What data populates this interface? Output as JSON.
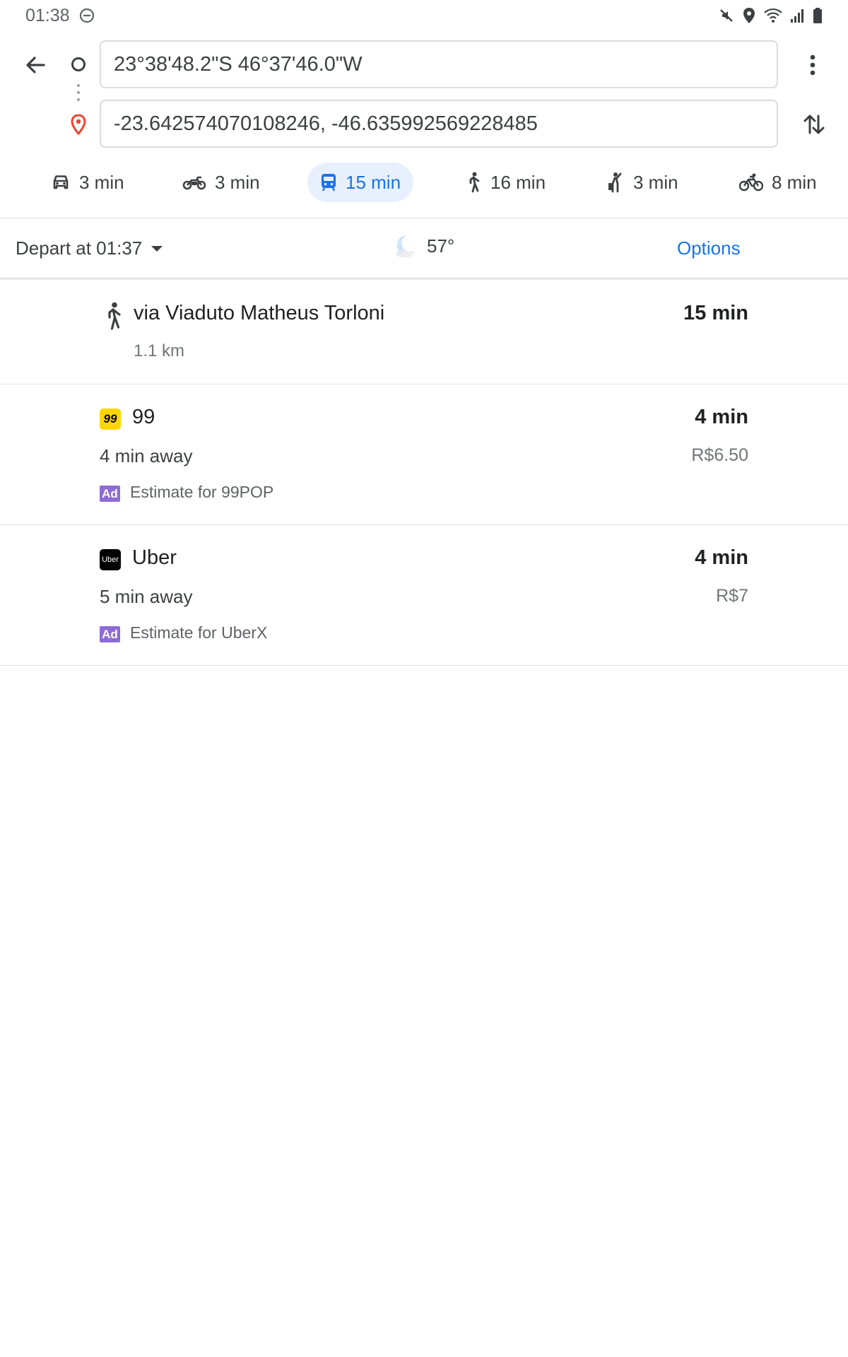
{
  "status_bar": {
    "time": "01:38",
    "icons": [
      "do-not-disturb-icon",
      "mute-icon",
      "location-icon",
      "wifi-icon",
      "signal-icon",
      "battery-icon"
    ]
  },
  "search": {
    "origin": "23°38'48.2\"S 46°37'46.0\"W",
    "destination": "-23.642574070108246, -46.635992569228485"
  },
  "modes": [
    {
      "name": "drive",
      "icon": "car-icon",
      "label": "3 min",
      "selected": false
    },
    {
      "name": "motorcycle",
      "icon": "motorcycle-icon",
      "label": "3 min",
      "selected": false
    },
    {
      "name": "transit",
      "icon": "train-icon",
      "label": "15 min",
      "selected": true
    },
    {
      "name": "walk",
      "icon": "walking-icon",
      "label": "16 min",
      "selected": false
    },
    {
      "name": "ride-hailing",
      "icon": "hail-icon",
      "label": "3 min",
      "selected": false
    },
    {
      "name": "bike",
      "icon": "bicycle-icon",
      "label": "8 min",
      "selected": false
    }
  ],
  "depart": {
    "label": "Depart at 01:37",
    "weather_icon": "moon-cloud-icon",
    "temperature": "57°",
    "options_label": "Options"
  },
  "routes": {
    "walk": {
      "title": "via Viaduto Matheus Torloni",
      "distance": "1.1 km",
      "duration": "15 min"
    },
    "rides": [
      {
        "logo_text": "99",
        "name": "99",
        "away": "4 min away",
        "duration": "4 min",
        "price": "R$6.50",
        "ad_label": "Ad",
        "estimate": "Estimate for 99POP"
      },
      {
        "logo_text": "Uber",
        "name": "Uber",
        "away": "5 min away",
        "duration": "4 min",
        "price": "R$7",
        "ad_label": "Ad",
        "estimate": "Estimate for UberX"
      }
    ]
  },
  "colors": {
    "accent": "#1a73e8",
    "selected_bg": "#e8f0fe",
    "pin_red": "#ea4335",
    "ad_purple": "#8e6bd6",
    "brand_99": "#ffd600"
  }
}
